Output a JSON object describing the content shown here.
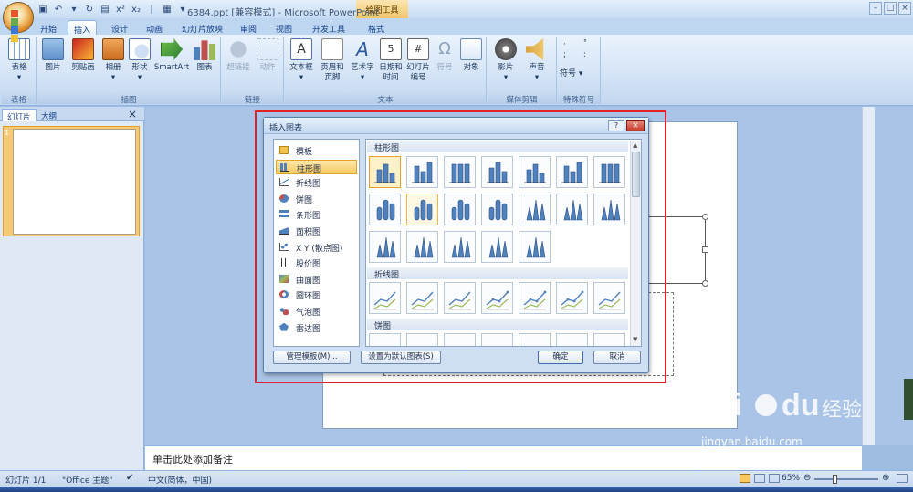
{
  "window": {
    "title": "6384.ppt [兼容模式] - Microsoft PowerPoint",
    "context_tab": "绘图工具"
  },
  "tabs": [
    "开始",
    "插入",
    "设计",
    "动画",
    "幻灯片放映",
    "审阅",
    "视图",
    "开发工具",
    "格式"
  ],
  "ribbon": {
    "groups": [
      {
        "label": "表格",
        "buttons": [
          "表格"
        ]
      },
      {
        "label": "插图",
        "buttons": [
          "图片",
          "剪贴画",
          "相册",
          "形状",
          "SmartArt",
          "图表"
        ]
      },
      {
        "label": "链接",
        "buttons": [
          "超链接",
          "动作"
        ]
      },
      {
        "label": "文本",
        "buttons": [
          "文本框",
          "页眉和\n页脚",
          "艺术字",
          "日期和\n时间",
          "幻灯片\n编号",
          "符号",
          "对象"
        ]
      },
      {
        "label": "媒体剪辑",
        "buttons": [
          "影片",
          "声音"
        ]
      },
      {
        "label": "特殊符号",
        "buttons": [
          "符号"
        ]
      }
    ]
  },
  "panel": {
    "tabs": [
      "幻灯片",
      "大纲"
    ],
    "close": "×",
    "slide_number": "1"
  },
  "notes": {
    "placeholder": "单击此处添加备注"
  },
  "dialog": {
    "title": "插入图表",
    "help": "?",
    "close": "×",
    "categories": [
      {
        "label": "模板",
        "icon": "folder-icon"
      },
      {
        "label": "柱形图",
        "icon": "column-chart-icon",
        "selected": true
      },
      {
        "label": "折线图",
        "icon": "line-chart-icon"
      },
      {
        "label": "饼图",
        "icon": "pie-chart-icon"
      },
      {
        "label": "条形图",
        "icon": "bar-chart-icon"
      },
      {
        "label": "面积图",
        "icon": "area-chart-icon"
      },
      {
        "label": "X Y (散点图)",
        "icon": "scatter-chart-icon"
      },
      {
        "label": "股价图",
        "icon": "stock-chart-icon"
      },
      {
        "label": "曲面图",
        "icon": "surface-chart-icon"
      },
      {
        "label": "圆环图",
        "icon": "doughnut-chart-icon"
      },
      {
        "label": "气泡图",
        "icon": "bubble-chart-icon"
      },
      {
        "label": "雷达图",
        "icon": "radar-chart-icon"
      }
    ],
    "sections": [
      "柱形图",
      "折线图",
      "饼图"
    ],
    "buttons": {
      "manage": "管理模板(M)...",
      "set_default": "设置为默认图表(S)",
      "ok": "确定",
      "cancel": "取消"
    }
  },
  "status": {
    "slide": "幻灯片 1/1",
    "theme": "\"Office 主题\"",
    "language": "中文(简体，中国)",
    "zoom": "65%"
  },
  "watermark": {
    "brand": "Bai",
    "brand_suffix": "du",
    "brand_cn": "经验",
    "url": "jingyan.baidu.com"
  },
  "colors": {
    "accent_orange": "#f7c85d",
    "chart_blue": "#4f81bd",
    "selection_red": "#e0202a"
  }
}
